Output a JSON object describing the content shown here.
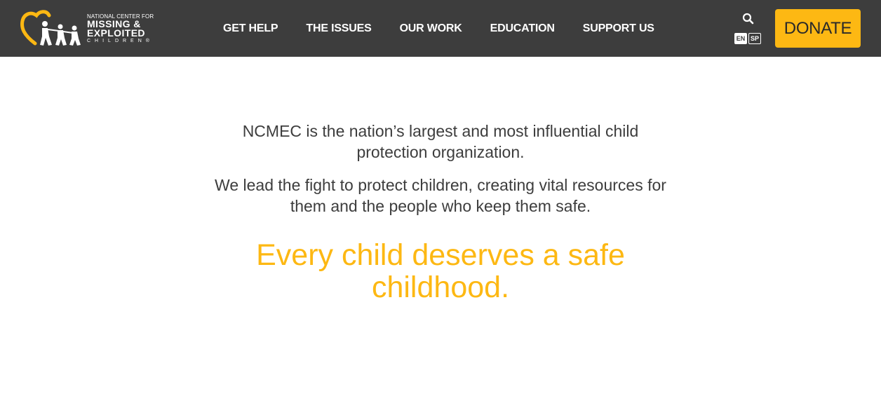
{
  "colors": {
    "header_bg": "#3d3d3d",
    "accent": "#fdb813",
    "body_text": "#3d3d3d",
    "background": "#ffffff"
  },
  "logo": {
    "line1": "NATIONAL CENTER FOR",
    "line2": "MISSING &",
    "line3": "EXPLOITED",
    "line4": "CHILDREN®",
    "icon": "heart-children-logo-icon"
  },
  "nav": {
    "items": [
      {
        "label": "GET HELP"
      },
      {
        "label": "THE ISSUES"
      },
      {
        "label": "OUR WORK"
      },
      {
        "label": "EDUCATION"
      },
      {
        "label": "SUPPORT US"
      }
    ]
  },
  "header": {
    "search_icon": "search-icon",
    "lang_en": "EN",
    "lang_sp": "SP",
    "donate_label": "DONATE"
  },
  "main": {
    "intro_1": "NCMEC is the nation’s largest and most influential child protection organization.",
    "intro_2": "We lead the fight to protect children, creating vital resources for them and the people who keep them safe.",
    "tagline": "Every child deserves a safe childhood."
  }
}
